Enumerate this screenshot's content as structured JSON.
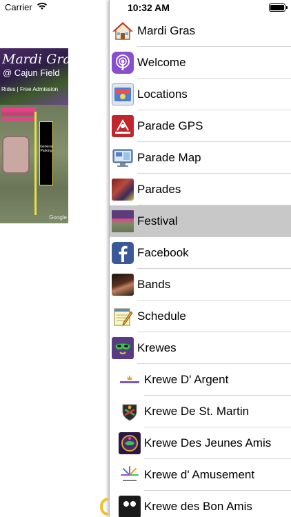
{
  "left_status": {
    "carrier": "Carrier"
  },
  "status_bar": {
    "time": "10:32 AM"
  },
  "flyer": {
    "title": "Mardi Gras",
    "subtitle": "@ Cajun Field",
    "tagline": "Rides  |  Free Admission",
    "parking_label": "General Parking",
    "map_credit": "Google"
  },
  "menu": {
    "items": [
      {
        "label": "Mardi Gras",
        "icon": "house-icon"
      },
      {
        "label": "Welcome",
        "icon": "podcast-icon"
      },
      {
        "label": "Locations",
        "icon": "locations-icon"
      },
      {
        "label": "Parade GPS",
        "icon": "gps-tracker-icon"
      },
      {
        "label": "Parade Map",
        "icon": "monitor-icon"
      },
      {
        "label": "Parades",
        "icon": "parade-photo-icon"
      },
      {
        "label": "Festival",
        "icon": "festival-flyer-icon",
        "selected": true
      },
      {
        "label": "Facebook",
        "icon": "facebook-icon"
      },
      {
        "label": "Bands",
        "icon": "band-photo-icon"
      },
      {
        "label": "Schedule",
        "icon": "notepad-icon"
      },
      {
        "label": "Krewes",
        "icon": "mask-icon"
      },
      {
        "label": "Krewe D' Argent",
        "icon": "krewe-argent-logo"
      },
      {
        "label": "Krewe De St. Martin",
        "icon": "krewe-st-martin-crest"
      },
      {
        "label": "Krewe Des Jeunes Amis",
        "icon": "krewe-jeunes-amis-logo"
      },
      {
        "label": "Krewe d' Amusement",
        "icon": "krewe-amusement-logo"
      },
      {
        "label": "Krewe des Bon Amis",
        "icon": "krewe-bon-amis-logo"
      }
    ]
  },
  "colors": {
    "selected_row": "#c8c8c8",
    "separator": "#d5d5d5",
    "facebook_blue": "#3b5998"
  }
}
